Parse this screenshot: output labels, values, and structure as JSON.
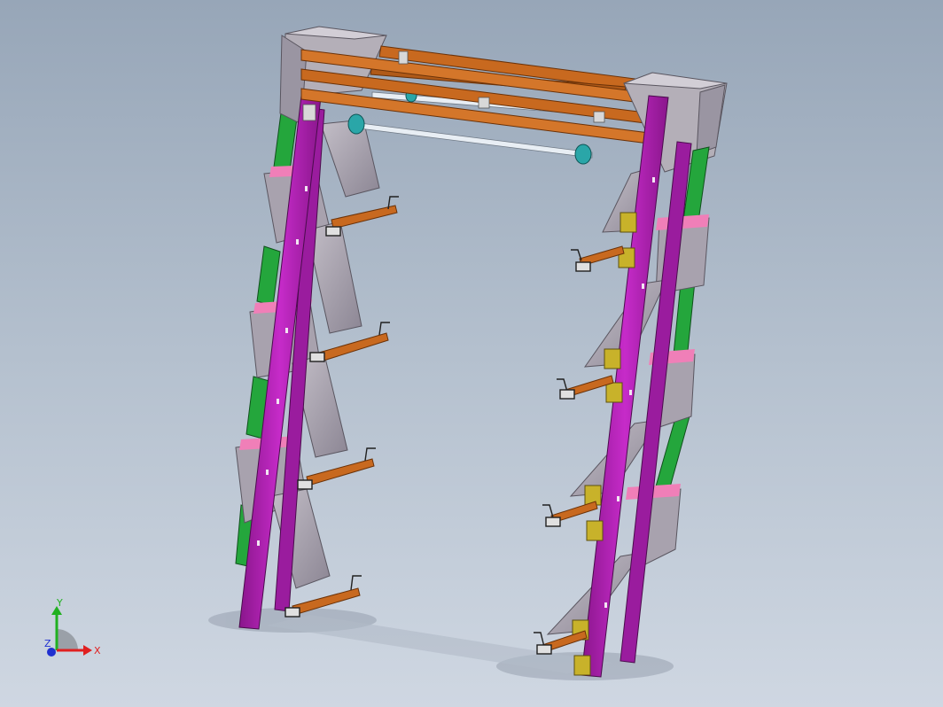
{
  "colors": {
    "background_top": "#97a6b8",
    "background_bottom": "#cfd7e2",
    "post": "#b21fb5",
    "post_edge": "#5a0f5c",
    "beam": "#c8691f",
    "beam_edge": "#6b3208",
    "chute": "#a8a2ae",
    "chute_dark": "#8c8694",
    "chute_side": "#c4bfc8",
    "green_link": "#24a63c",
    "pink_plate": "#f07fb8",
    "yellow_bracket": "#c8b22a",
    "shaft": "#e8eef4",
    "cyan_hub": "#2aa6a8",
    "axis_x": "#e02020",
    "axis_y": "#20b020",
    "axis_z": "#2030d0"
  },
  "triad": {
    "x_label": "X",
    "y_label": "Y",
    "z_label": "Z"
  }
}
